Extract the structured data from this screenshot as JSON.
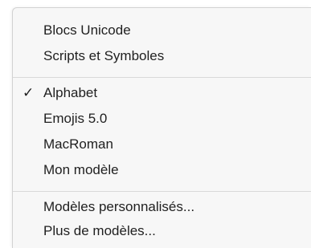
{
  "menu": {
    "group1": [
      {
        "label": "Blocs Unicode"
      },
      {
        "label": "Scripts et Symboles"
      }
    ],
    "group2": [
      {
        "label": "Alphabet",
        "checked": true
      },
      {
        "label": "Emojis 5.0"
      },
      {
        "label": "MacRoman"
      },
      {
        "label": "Mon modèle"
      }
    ],
    "group3": [
      {
        "label": "Modèles personnalisés..."
      },
      {
        "label": "Plus de modèles..."
      }
    ],
    "check_glyph": "✓"
  }
}
